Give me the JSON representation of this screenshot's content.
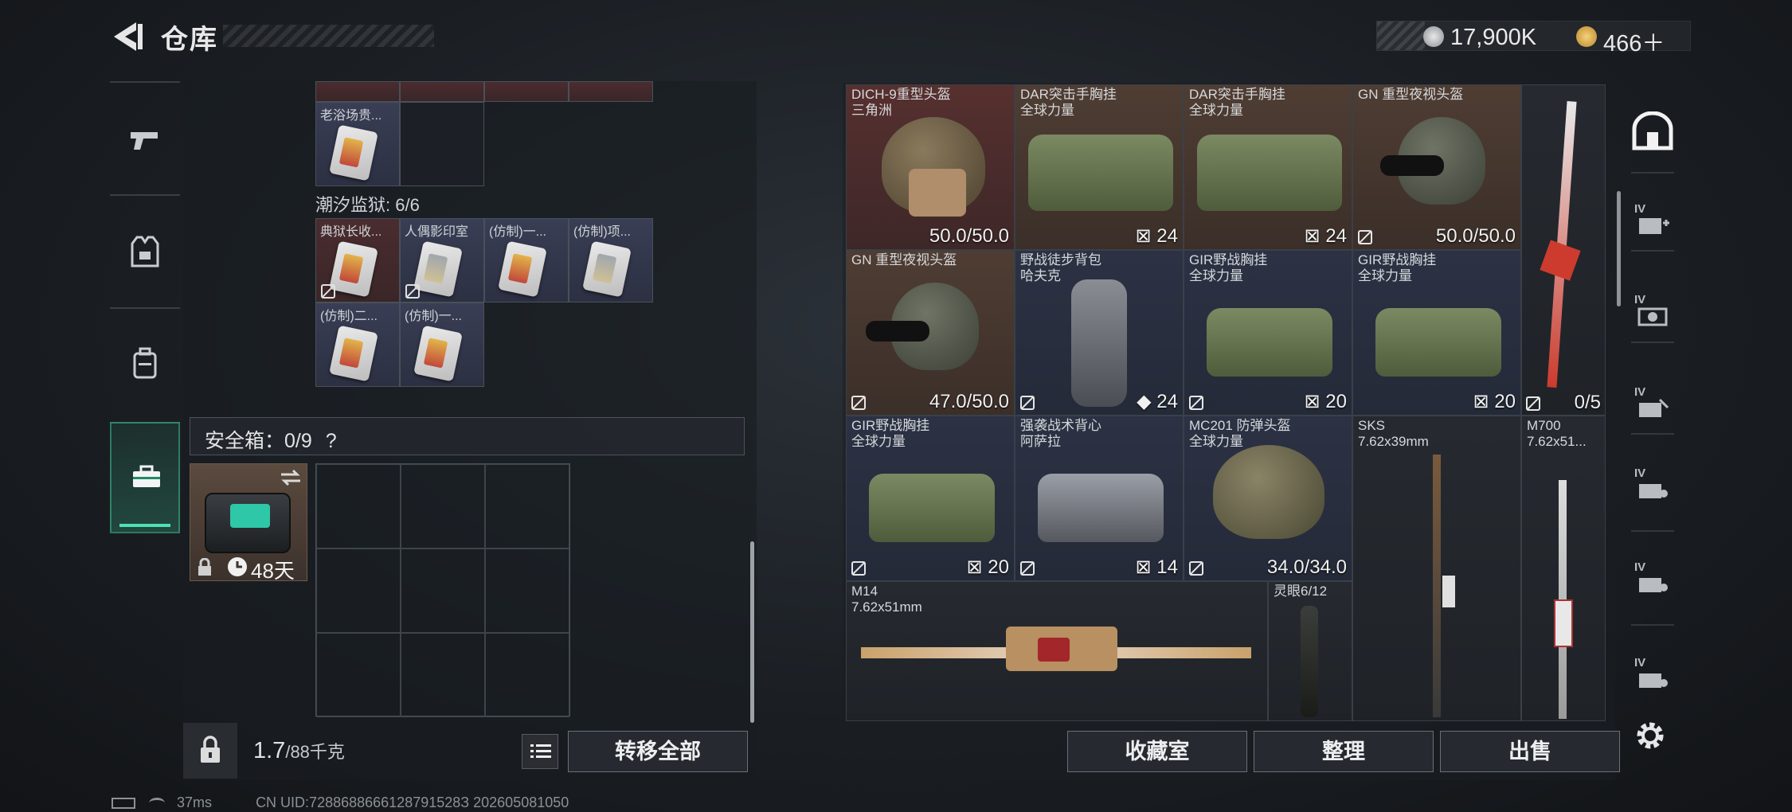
{
  "header": {
    "title": "仓库",
    "currency_primary": "17,900K",
    "currency_secondary": "466＋"
  },
  "left_panel": {
    "top_partial_item": "老浴场贵...",
    "prison_label": "潮汐监狱: 6/6",
    "prison_items": [
      "典狱长收...",
      "人偶影印室",
      "(仿制)一...",
      "(仿制)项...",
      "(仿制)二...",
      "(仿制)一..."
    ],
    "safebox_label": "安全箱：0/9",
    "safebox_help": "?",
    "safebox_days": "48天",
    "weight_value": "1.7",
    "weight_unit": "/88千克",
    "transfer_all": "转移全部"
  },
  "stash": {
    "items": [
      {
        "name": "DICH-9重型头盔",
        "sub": "三角洲",
        "value": "50.0/50.0"
      },
      {
        "name": "DAR突击手胸挂",
        "sub": "全球力量",
        "value": "24"
      },
      {
        "name": "DAR突击手胸挂",
        "sub": "全球力量",
        "value": "24"
      },
      {
        "name": "GN 重型夜视头盔",
        "sub": "",
        "value": "50.0/50.0"
      },
      {
        "name": "GN 重型夜视头盔",
        "sub": "",
        "value": "47.0/50.0"
      },
      {
        "name": "野战徒步背包",
        "sub": "哈夫克",
        "value": "24"
      },
      {
        "name": "GIR野战胸挂",
        "sub": "全球力量",
        "value": "20"
      },
      {
        "name": "GIR野战胸挂",
        "sub": "全球力量",
        "value": "20"
      },
      {
        "name": "",
        "sub": "",
        "value": "0/5"
      },
      {
        "name": "GIR野战胸挂",
        "sub": "全球力量",
        "value": "20"
      },
      {
        "name": "强袭战术背心",
        "sub": "阿萨拉",
        "value": "14"
      },
      {
        "name": "MC201 防弹头盔",
        "sub": "全球力量",
        "value": "34.0/34.0"
      },
      {
        "name": "SKS",
        "sub": "7.62x39mm",
        "value": ""
      },
      {
        "name": "M700",
        "sub": "7.62x51...",
        "value": ""
      },
      {
        "name": "M14",
        "sub": "7.62x51mm",
        "value": ""
      },
      {
        "name": "灵眼6/12",
        "sub": "",
        "value": ""
      }
    ]
  },
  "right_rail": {
    "tags": [
      "IV",
      "IV",
      "IV",
      "IV",
      "IV",
      "IV"
    ]
  },
  "actions": {
    "collection": "收藏室",
    "sort": "整理",
    "sell": "出售"
  },
  "status_bar": {
    "ping": "37ms",
    "uid": "CN UID:7288688666128791528З 202605081050"
  },
  "colors": {
    "accent": "#4fe0b0",
    "red_item": "#56302f",
    "brown_item": "#4f3d33",
    "slate_item": "#2c3244"
  }
}
